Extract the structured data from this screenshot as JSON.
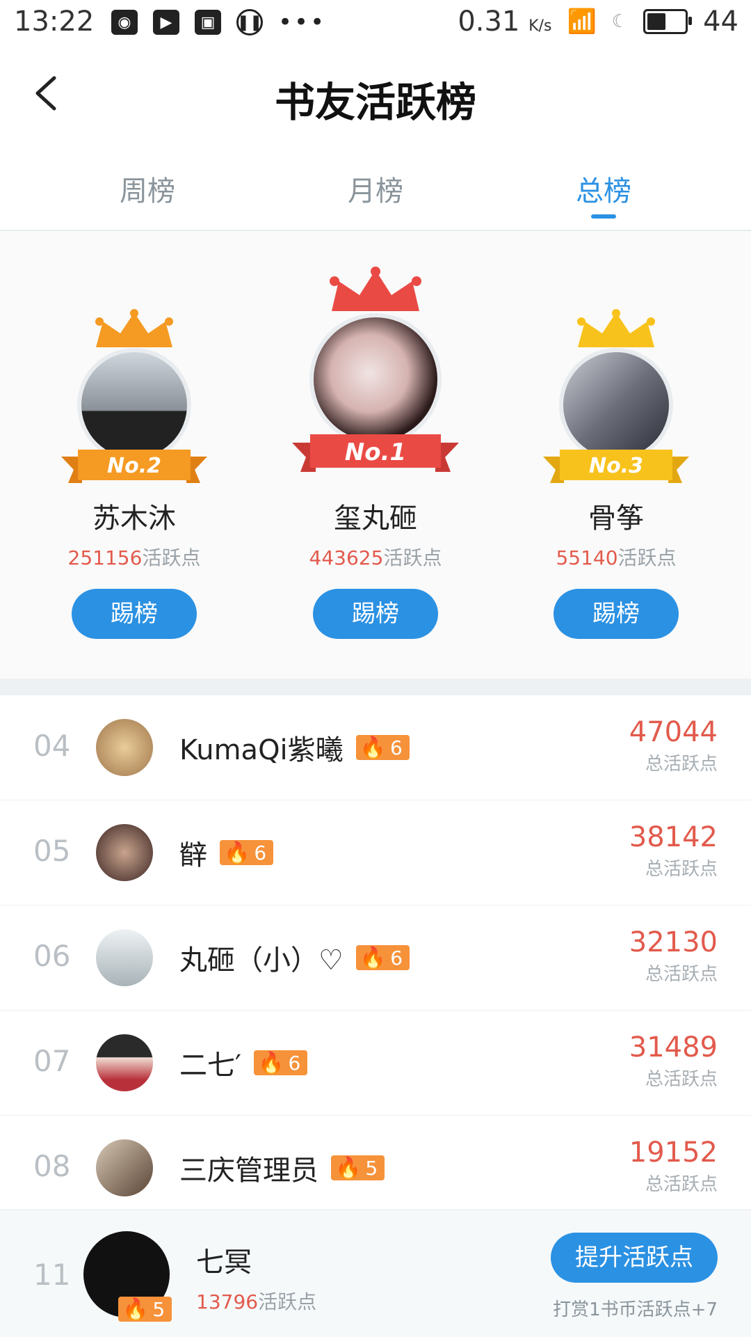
{
  "status_bar": {
    "time": "13:22",
    "speed": "0.31",
    "speed_unit": "K/s",
    "battery": "44"
  },
  "header": {
    "title": "书友活跃榜"
  },
  "tabs": [
    {
      "label": "周榜",
      "active": false
    },
    {
      "label": "月榜",
      "active": false
    },
    {
      "label": "总榜",
      "active": true
    }
  ],
  "podium": [
    {
      "rank_label": "No.2",
      "name": "苏木沐",
      "points": "251156",
      "points_unit": "活跃点",
      "button": "踢榜",
      "crown_color": "#f59a23"
    },
    {
      "rank_label": "No.1",
      "name": "玺丸砸",
      "points": "443625",
      "points_unit": "活跃点",
      "button": "踢榜",
      "crown_color": "#ea4a44"
    },
    {
      "rank_label": "No.3",
      "name": "骨筝",
      "points": "55140",
      "points_unit": "活跃点",
      "button": "踢榜",
      "crown_color": "#f8c21c"
    }
  ],
  "list": [
    {
      "rank": "04",
      "name": "KumaQi紫曦",
      "level": "6",
      "score": "47044",
      "score_label": "总活跃点"
    },
    {
      "rank": "05",
      "name": "辥",
      "level": "6",
      "score": "38142",
      "score_label": "总活跃点"
    },
    {
      "rank": "06",
      "name": "丸砸（小）♡",
      "level": "6",
      "score": "32130",
      "score_label": "总活跃点"
    },
    {
      "rank": "07",
      "name": "二七′",
      "level": "6",
      "score": "31489",
      "score_label": "总活跃点"
    },
    {
      "rank": "08",
      "name": "三庆管理员",
      "level": "5",
      "score": "19152",
      "score_label": "总活跃点"
    }
  ],
  "me": {
    "rank": "11",
    "name": "七冥",
    "level": "5",
    "points": "13796",
    "points_unit": "活跃点",
    "button": "提升活跃点",
    "hint": "打赏1书币活跃点+7"
  }
}
